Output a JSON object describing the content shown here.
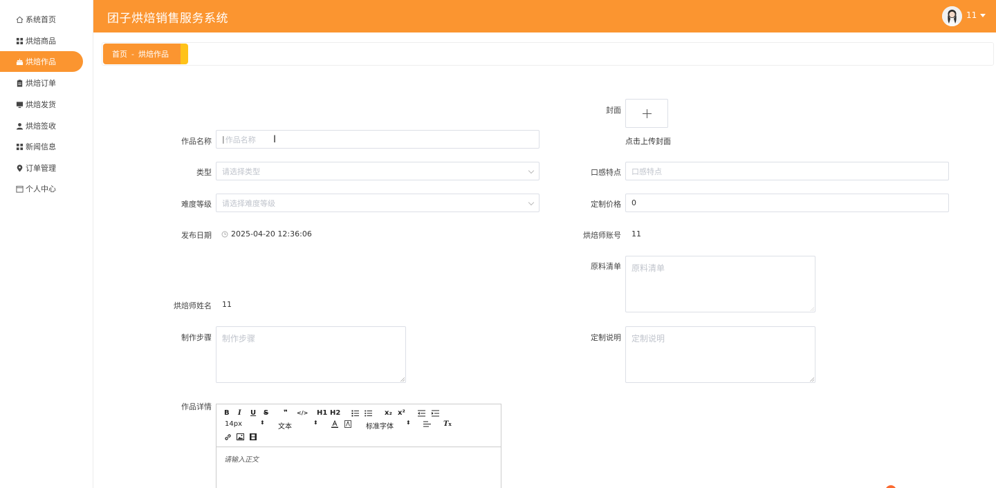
{
  "app": {
    "title": "团子烘焙销售服务系统",
    "username": "11"
  },
  "sidebar": {
    "items": [
      {
        "label": "系统首页",
        "icon": "home-icon"
      },
      {
        "label": "烘焙商品",
        "icon": "grid-icon"
      },
      {
        "label": "烘焙作品",
        "icon": "cake-icon",
        "active": true
      },
      {
        "label": "烘焙订单",
        "icon": "clipboard-icon"
      },
      {
        "label": "烘焙发货",
        "icon": "monitor-icon"
      },
      {
        "label": "烘焙签收",
        "icon": "user-icon"
      },
      {
        "label": "新闻信息",
        "icon": "grid-icon"
      },
      {
        "label": "订单管理",
        "icon": "pin-icon"
      },
      {
        "label": "个人中心",
        "icon": "calendar-icon"
      }
    ]
  },
  "breadcrumb": {
    "home": "首页",
    "separator": "-",
    "current": "烘焙作品"
  },
  "form": {
    "cover": {
      "label": "封面",
      "hint": "点击上传封面"
    },
    "name": {
      "label": "作品名称",
      "placeholder": "作品名称"
    },
    "type": {
      "label": "类型",
      "placeholder": "请选择类型"
    },
    "taste": {
      "label": "口感特点",
      "placeholder": "口感特点"
    },
    "difficulty": {
      "label": "难度等级",
      "placeholder": "请选择难度等级"
    },
    "price": {
      "label": "定制价格",
      "value": "0"
    },
    "publish_date": {
      "label": "发布日期",
      "value": "2025-04-20 12:36:06"
    },
    "baker_account": {
      "label": "烘焙师账号",
      "value": "11"
    },
    "ingredients": {
      "label": "原料清单",
      "placeholder": "原料清单"
    },
    "baker_name": {
      "label": "烘焙师姓名",
      "value": "11"
    },
    "steps": {
      "label": "制作步骤",
      "placeholder": "制作步骤"
    },
    "custom_note": {
      "label": "定制说明",
      "placeholder": "定制说明"
    },
    "detail": {
      "label": "作品详情",
      "placeholder": "请输入正文"
    }
  },
  "editor": {
    "font_size": "14px",
    "block_type": "文本",
    "font_family": "标准字体",
    "buttons": [
      "B",
      "I",
      "U",
      "S",
      "❞",
      "</>",
      "H1",
      "H2",
      "ol",
      "ul",
      "x₂",
      "x²",
      "outdent",
      "indent"
    ]
  },
  "colors": {
    "accent": "#fb9530",
    "accent_tail": "#ffc21a"
  }
}
